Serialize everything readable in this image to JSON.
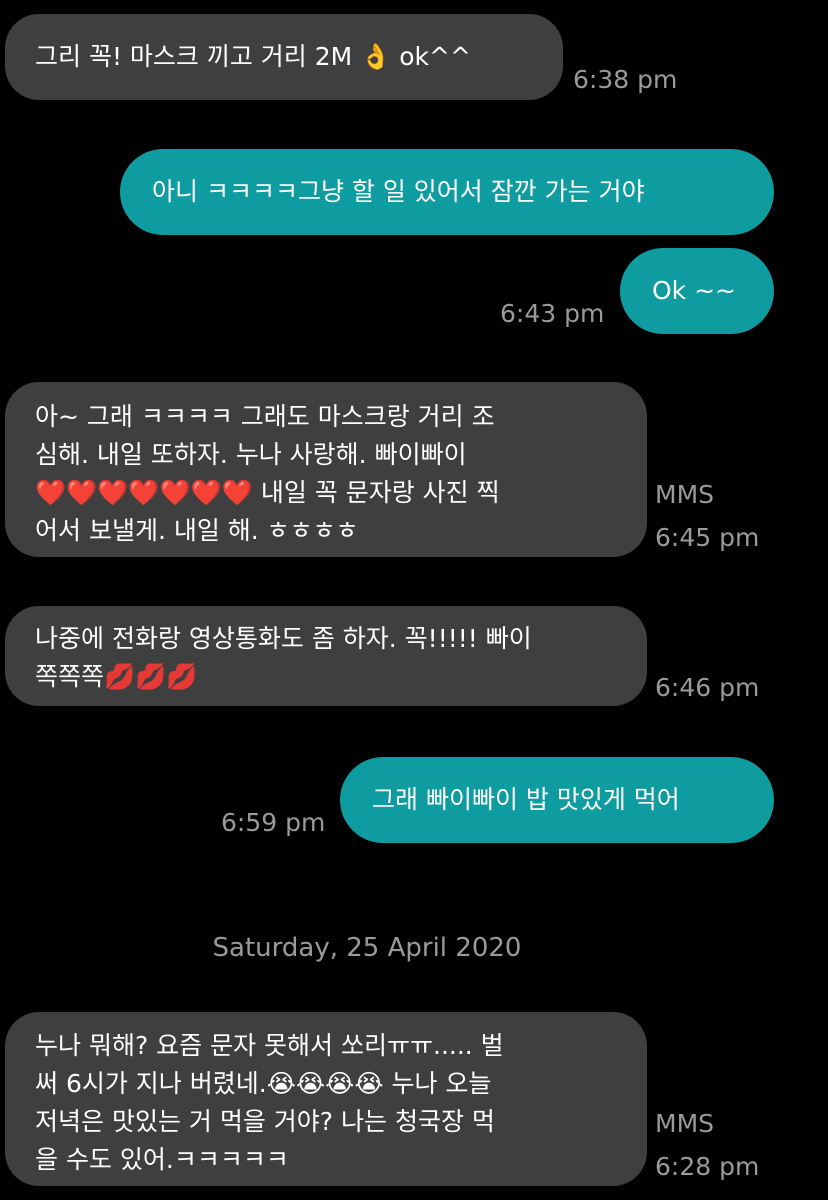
{
  "colors": {
    "background": "#000000",
    "incoming_bubble": "#3f3f3f",
    "outgoing_bubble": "#0f9ca0",
    "meta_text": "#9a9a9a"
  },
  "messages": [
    {
      "direction": "incoming",
      "lines": [
        "그리 꼭! 마스크 끼고 거리 2M 👌 ok^^"
      ],
      "time": "6:38 pm"
    },
    {
      "direction": "outgoing",
      "lines": [
        "아니 ㅋㅋㅋㅋ그냥 할 일 있어서 잠깐 가는 거야"
      ]
    },
    {
      "direction": "outgoing",
      "lines": [
        "Ok ~~"
      ],
      "time": "6:43 pm"
    },
    {
      "direction": "incoming",
      "lines": [
        "아~ 그래 ㅋㅋㅋㅋ 그래도 마스크랑 거리 조",
        "심해. 내일 또하자. 누나 사랑해. 빠이빠이",
        "❤️❤️❤️❤️❤️❤️❤️ 내일 꼭 문자랑 사진 찍",
        "어서 보낼게. 내일 해. ㅎㅎㅎㅎ"
      ],
      "badge": "MMS",
      "time": "6:45 pm"
    },
    {
      "direction": "incoming",
      "lines": [
        "나중에 전화랑 영상통화도 좀 하자. 꼭!!!!! 빠이",
        "쪽쪽쪽💋💋💋"
      ],
      "time": "6:46 pm"
    },
    {
      "direction": "outgoing",
      "lines": [
        "그래 빠이빠이 밥 맛있게 먹어"
      ],
      "time": "6:59 pm"
    },
    {
      "direction": "incoming",
      "lines": [
        "누나 뭐해?  요즘 문자 못해서 쏘리ㅠㅠ..... 벌",
        "써 6시가 지나 버렸네.😭😭😭😭  누나 오늘",
        "저녁은 맛있는 거 먹을 거야?  나는 청국장 먹",
        "을 수도 있어.ㅋㅋㅋㅋㅋ"
      ],
      "badge": "MMS",
      "time": "6:28 pm"
    }
  ],
  "date_separator": "Saturday, 25 April 2020"
}
